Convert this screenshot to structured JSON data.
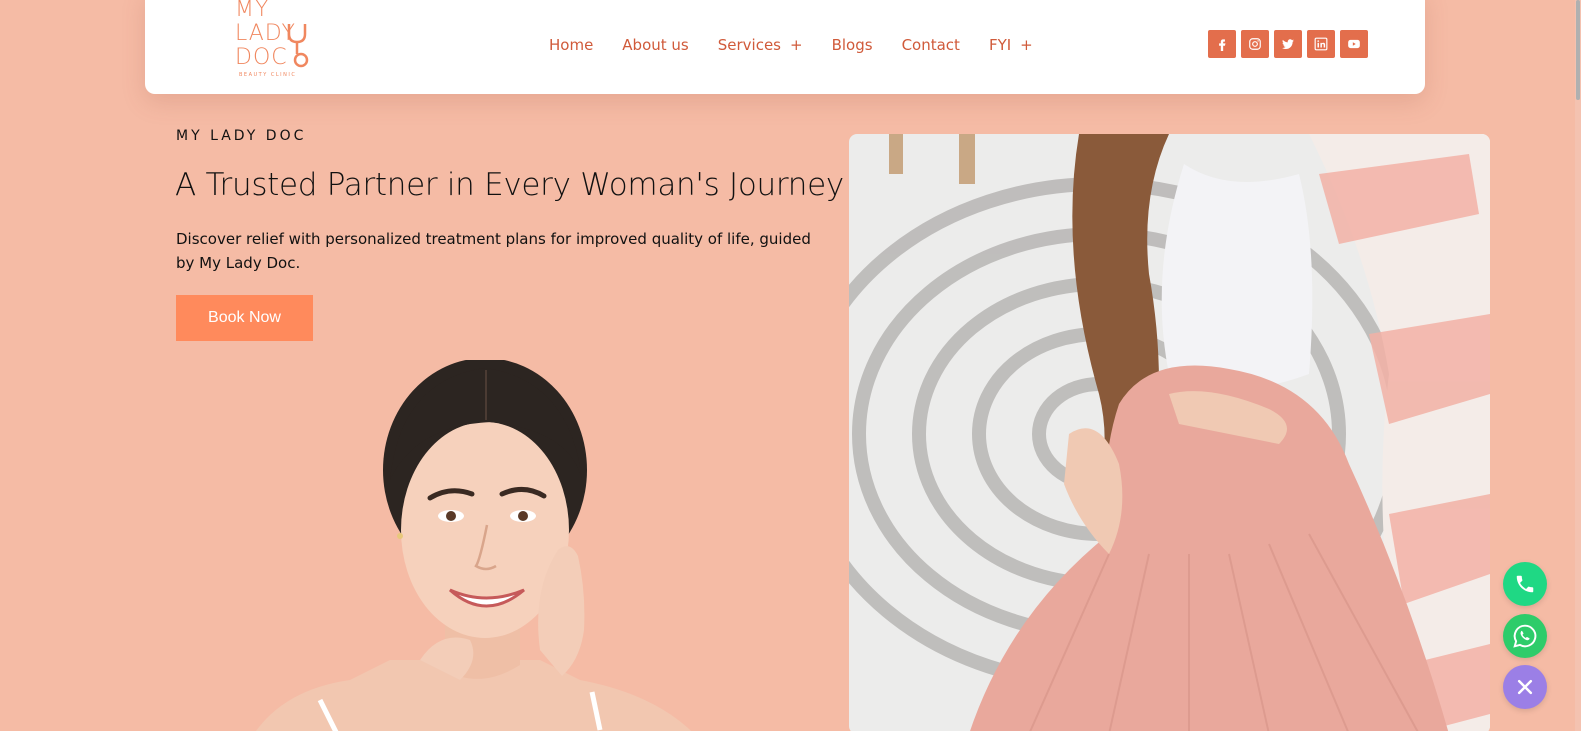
{
  "brand": {
    "logo_lines": [
      "MY",
      "LADY",
      "DOC"
    ],
    "logo_tagline": "BEAUTY CLINIC"
  },
  "nav": {
    "items": [
      {
        "label": "Home"
      },
      {
        "label": "About us"
      },
      {
        "label": "Services",
        "has_submenu": true
      },
      {
        "label": "Blogs"
      },
      {
        "label": "Contact"
      },
      {
        "label": "FYI",
        "has_submenu": true
      }
    ],
    "submenu_indicator": "+"
  },
  "socials": [
    "facebook-icon",
    "instagram-icon",
    "twitter-icon",
    "linkedin-icon",
    "youtube-icon"
  ],
  "hero": {
    "eyebrow": "MY LADY DOC",
    "headline": "A Trusted Partner in Every Woman's Journey",
    "description": "Discover relief with personalized treatment plans for improved quality of life, guided by My Lady Doc.",
    "cta_label": "Book Now"
  },
  "colors": {
    "background": "#f5bba5",
    "accent": "#ff8a5c",
    "nav_text": "#d05a3a",
    "social_bg": "#e36e4c",
    "phone_fab": "#1fd884",
    "whatsapp_fab": "#2ecc6a",
    "close_fab": "#9b7fe6"
  },
  "fabs": [
    "phone-icon",
    "whatsapp-icon",
    "close-icon"
  ]
}
